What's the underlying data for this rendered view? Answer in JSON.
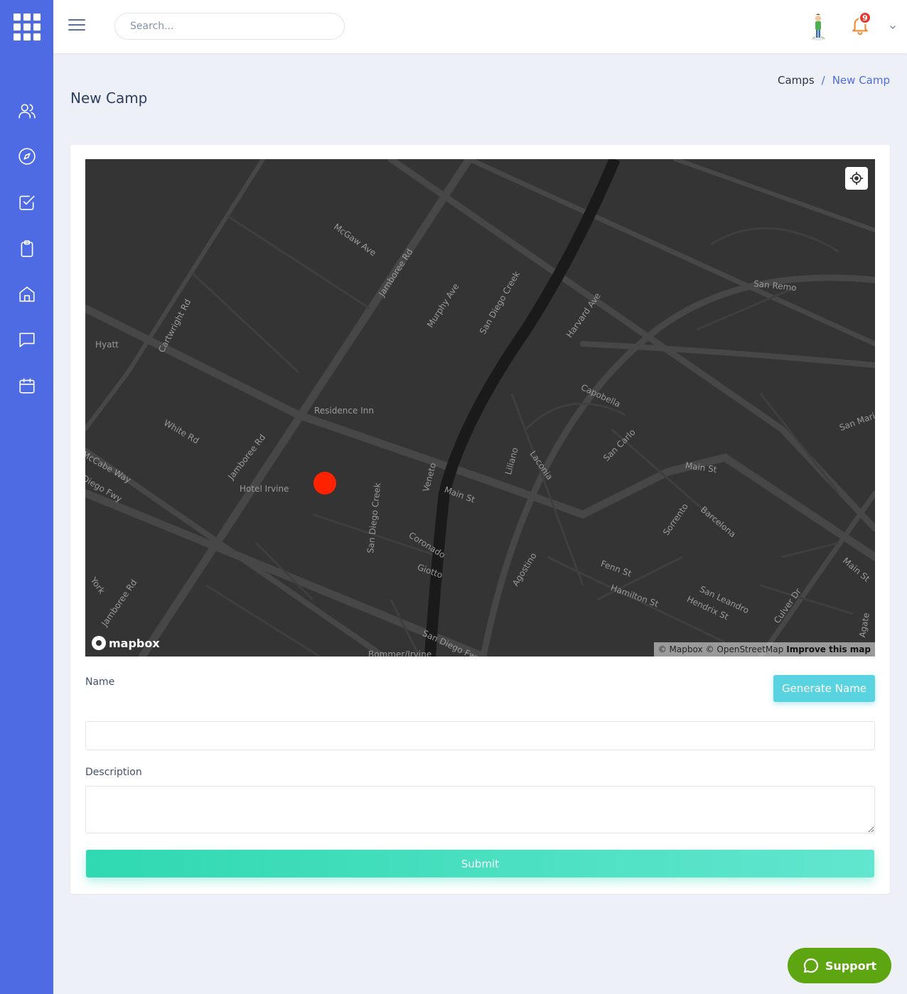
{
  "topbar": {
    "search_placeholder": "Search...",
    "notification_count": "9"
  },
  "page": {
    "title": "New Camp",
    "breadcrumb": [
      "Camps",
      "/",
      "New Camp"
    ]
  },
  "sidebar": {
    "items": [
      {
        "icon": "users-icon"
      },
      {
        "icon": "compass-icon"
      },
      {
        "icon": "checkbox-icon"
      },
      {
        "icon": "clipboard-icon"
      },
      {
        "icon": "home-icon"
      },
      {
        "icon": "chat-icon"
      },
      {
        "icon": "calendar-icon"
      }
    ]
  },
  "map": {
    "labels": [
      "McGaw Ave",
      "Jamboree Rd",
      "Murphy Ave",
      "San Diego Creek",
      "Harvard Ave",
      "San Remo",
      "Hyatt",
      "Cartwright Rd",
      "Residence Inn",
      "Capobella",
      "White Rd",
      "San Carlo",
      "San Marino",
      "Laconia",
      "Liliano",
      "McCabe Way",
      "Jamboree Rd",
      "Main St",
      "Diego Fwy",
      "Hotel Irvine",
      "Veneto",
      "Main St",
      "San Diego Creek",
      "Sorrento",
      "Barcelona",
      "Coronado",
      "Giotto",
      "Agostino",
      "Fenn St",
      "Hamilton St",
      "San Leandro",
      "Hendrix St",
      "Culver Dr",
      "Main St",
      "York",
      "Jamboree Rd",
      "San Diego Fwy",
      "Agate",
      "Bommer/Irvine"
    ],
    "logo_text": "mapbox",
    "attribution": {
      "mapbox": "© Mapbox",
      "osm": "© OpenStreetMap",
      "improve": "Improve this map"
    },
    "marker_color": "#ff2200"
  },
  "form": {
    "name_label": "Name",
    "generate_label": "Generate Name",
    "name_value": "",
    "description_label": "Description",
    "description_value": "",
    "submit_label": "Submit"
  },
  "support": {
    "label": "Support"
  },
  "colors": {
    "sidebar": "#4f6be3",
    "accent": "#4f6be3",
    "generate": "#59d3e0",
    "submit": "#2fd9b1",
    "support": "#5ea512"
  }
}
